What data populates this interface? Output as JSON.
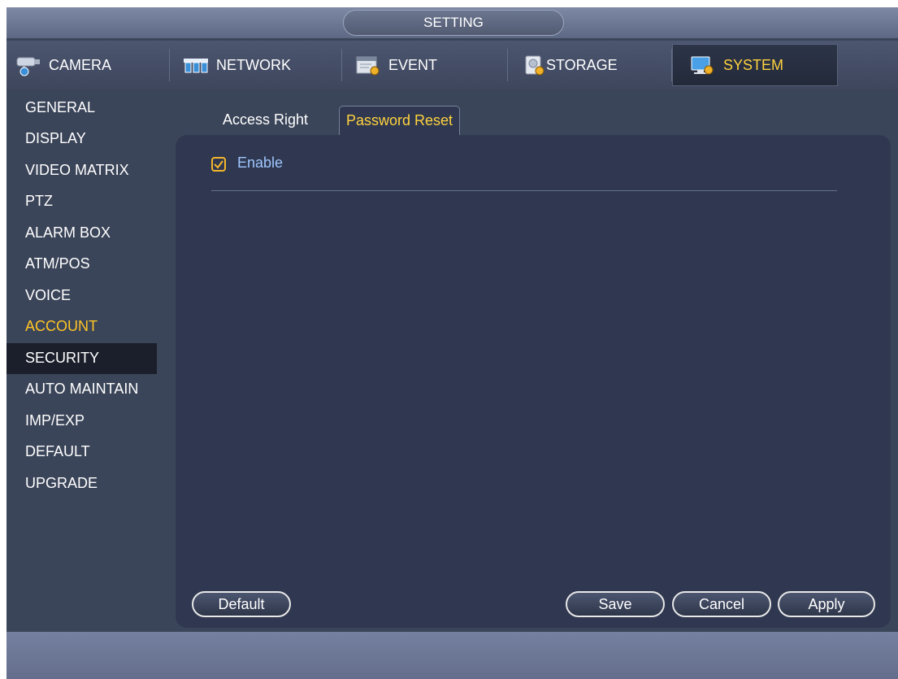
{
  "window": {
    "title": "SETTING"
  },
  "tabs": [
    {
      "label": "CAMERA",
      "icon": "camera-icon"
    },
    {
      "label": "NETWORK",
      "icon": "network-icon"
    },
    {
      "label": "EVENT",
      "icon": "event-icon"
    },
    {
      "label": "STORAGE",
      "icon": "storage-icon"
    },
    {
      "label": "SYSTEM",
      "icon": "system-icon",
      "active": true
    }
  ],
  "sidebar": {
    "items": [
      {
        "label": "GENERAL"
      },
      {
        "label": "DISPLAY"
      },
      {
        "label": "VIDEO MATRIX"
      },
      {
        "label": "PTZ"
      },
      {
        "label": "ALARM BOX"
      },
      {
        "label": "ATM/POS"
      },
      {
        "label": "VOICE"
      },
      {
        "label": "ACCOUNT",
        "state": "highlighted"
      },
      {
        "label": "SECURITY",
        "state": "selected"
      },
      {
        "label": "AUTO MAINTAIN"
      },
      {
        "label": "IMP/EXP"
      },
      {
        "label": "DEFAULT"
      },
      {
        "label": "UPGRADE"
      }
    ]
  },
  "subtabs": [
    {
      "label": "Access Right"
    },
    {
      "label": "Password Reset",
      "active": true
    }
  ],
  "form": {
    "enable_label": "Enable",
    "enable_checked": true
  },
  "buttons": {
    "default": "Default",
    "save": "Save",
    "cancel": "Cancel",
    "apply": "Apply"
  },
  "colors": {
    "accent": "#ffd23f",
    "checkbox": "#f6b62a",
    "enable_text": "#9fc6ff",
    "background": "#3b4559",
    "panel": "#2f3850"
  }
}
